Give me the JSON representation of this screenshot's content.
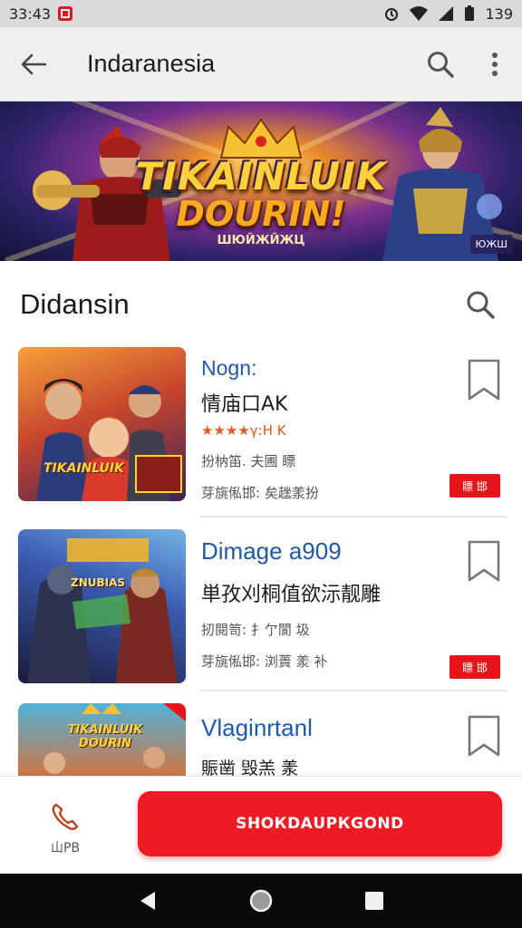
{
  "status_bar": {
    "time": "33:43",
    "battery_text": "139"
  },
  "app_bar": {
    "title": "Indaranesia",
    "back_icon": "arrow-left-icon",
    "search_icon": "search-icon",
    "menu_icon": "more-vert-icon"
  },
  "banner": {
    "title_line1": "TIKAINLUIK",
    "title_line2": "DOURIN!",
    "tagline": "ШЮЙЖЙЖЦ",
    "badge_text": "ЮЖШ"
  },
  "section": {
    "title": "Didansin",
    "search_icon": "search-icon"
  },
  "items": [
    {
      "title": "Nogn:",
      "subtitle": "情庙口ΑΚ",
      "rating_text": "★★★★γ:Η Κ",
      "meta1": "扮枘笛. 夫圃 瞟",
      "meta2": "芽旐俬邯: 矣趖羕扮",
      "tag": "瞟 邯",
      "thumb_logo": "TIKAINLUIK"
    },
    {
      "title": "Dimage a909",
      "subtitle": "単孜刈桐值欲沶靓雕",
      "rating_text": "",
      "meta1": "扨閱笥: 扌亇閬 圾",
      "meta2": "芽旐俬邯: 浏蕢 羕 补",
      "tag": "瞟 邯",
      "thumb_logo": "ZNUBIAS"
    },
    {
      "title": "Vlaginrtanl",
      "subtitle": "賑凿 毁羔 羕",
      "rating_text": "",
      "meta1": "",
      "meta2": "",
      "tag": "",
      "thumb_logo": "TIKAINLUIK DOURIN"
    }
  ],
  "bottom": {
    "call_label": "山ΡΒ",
    "cta_label": "SНОКDАUPКGОND"
  },
  "colors": {
    "accent": "#ee1b24",
    "link_blue": "#1e5aa8",
    "banner_gold": "#ffd23c"
  }
}
